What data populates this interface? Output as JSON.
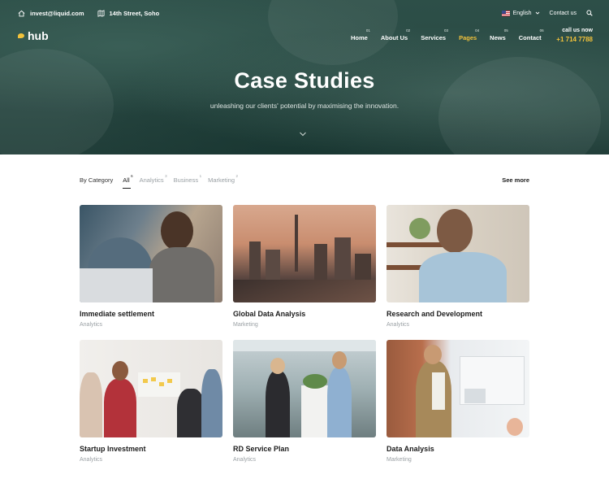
{
  "topbar": {
    "email": "invest@liquid.com",
    "address": "14th Street, Soho",
    "language": "English",
    "contact": "Contact us"
  },
  "brand": {
    "name": "hub"
  },
  "nav": [
    {
      "num": "01",
      "label": "Home"
    },
    {
      "num": "02",
      "label": "About Us"
    },
    {
      "num": "03",
      "label": "Services"
    },
    {
      "num": "04",
      "label": "Pages",
      "active": true
    },
    {
      "num": "05",
      "label": "News"
    },
    {
      "num": "06",
      "label": "Contact"
    }
  ],
  "callus": {
    "label": "call us now",
    "number": "+1 714 7788"
  },
  "hero": {
    "title": "Case Studies",
    "subtitle": "unleashing our clients' potential by maximising the innovation."
  },
  "filters": {
    "label": "By Category",
    "items": [
      {
        "label": "All",
        "count": "6",
        "active": true
      },
      {
        "label": "Analytics",
        "count": "3"
      },
      {
        "label": "Business",
        "count": "1"
      },
      {
        "label": "Marketing",
        "count": "2"
      }
    ],
    "see_more": "See more"
  },
  "cards": [
    {
      "title": "Immediate settlement",
      "category": "Analytics"
    },
    {
      "title": "Global Data Analysis",
      "category": "Marketing"
    },
    {
      "title": "Research and Development",
      "category": "Analytics"
    },
    {
      "title": "Startup Investment",
      "category": "Analytics"
    },
    {
      "title": "RD Service Plan",
      "category": "Analytics"
    },
    {
      "title": "Data Analysis",
      "category": "Marketing"
    }
  ],
  "colors": {
    "accent": "#f2c23b",
    "hero_bg": "#2a4a44",
    "muted": "#9aa0a4"
  }
}
